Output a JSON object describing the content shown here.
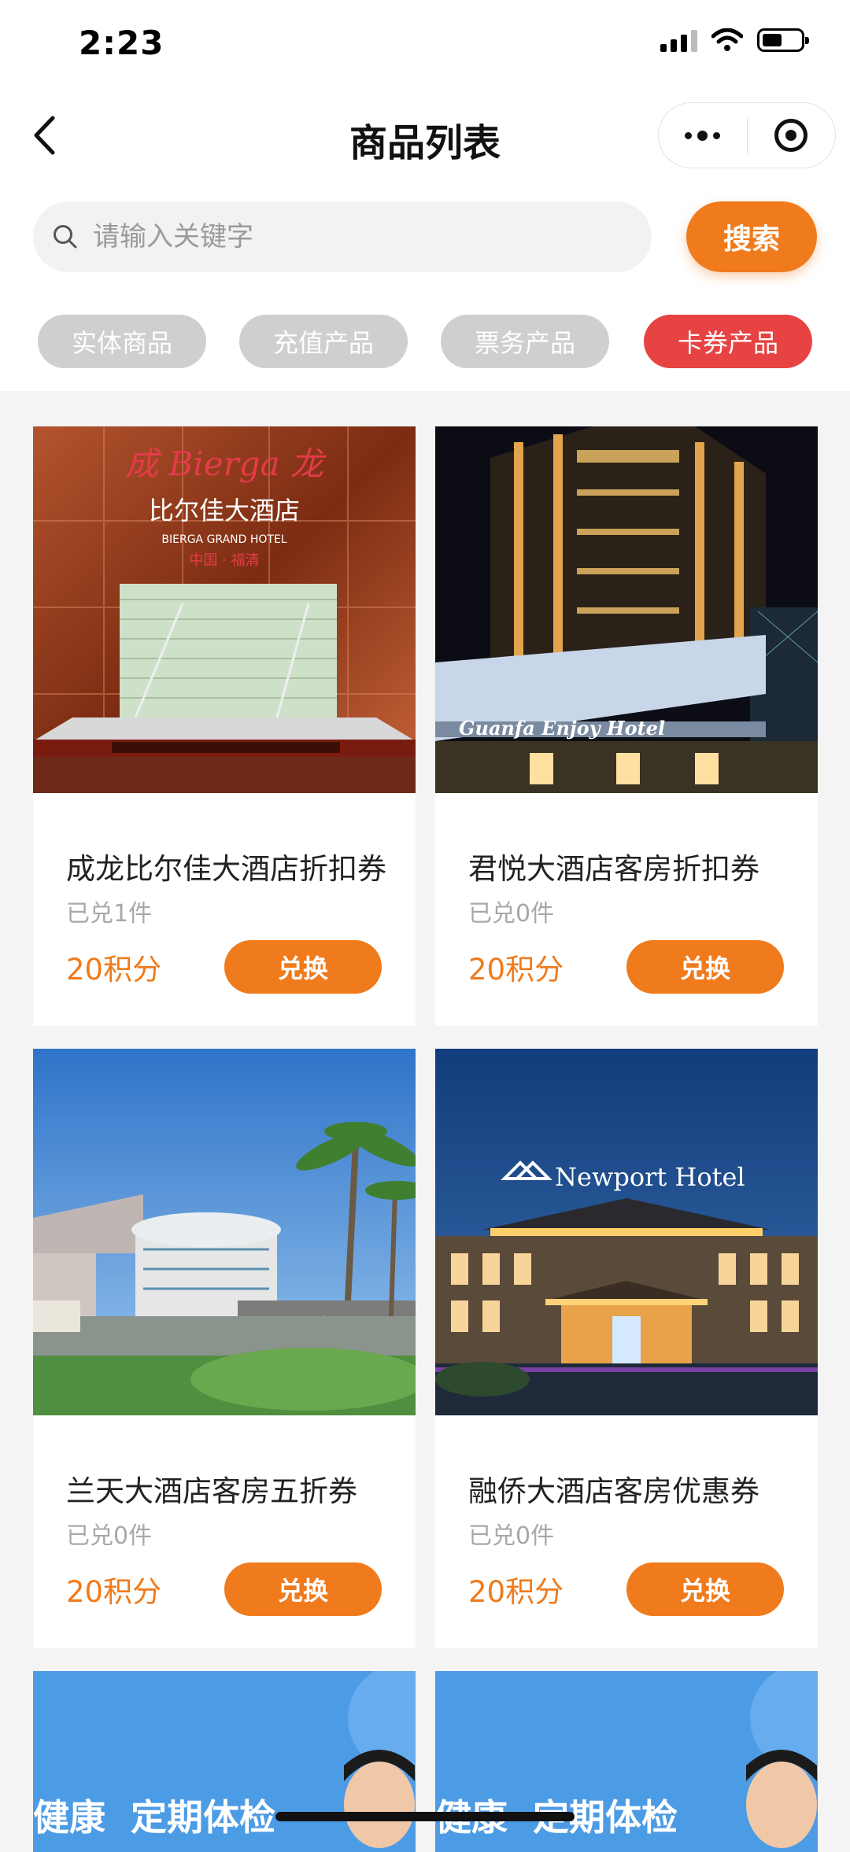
{
  "status_bar": {
    "time": "2:23"
  },
  "nav": {
    "title": "商品列表"
  },
  "search": {
    "placeholder": "请输入关键字",
    "button_label": "搜索"
  },
  "categories": [
    {
      "label": "实体商品",
      "active": false
    },
    {
      "label": "充值产品",
      "active": false
    },
    {
      "label": "票务产品",
      "active": false
    },
    {
      "label": "卡券产品",
      "active": true
    }
  ],
  "products": [
    {
      "name": "成龙比尔佳大酒店折扣券",
      "sold": "已兑1件",
      "price": "20积分",
      "button_label": "兑换",
      "image_text": [
        "成 Bierga 龙",
        "比尔佳大酒店",
        "BIERGA GRAND HOTEL",
        "中国 · 福清"
      ]
    },
    {
      "name": "君悦大酒店客房折扣券",
      "sold": "已兑0件",
      "price": "20积分",
      "button_label": "兑换",
      "image_text": [
        "Guanfa Enjoy Hotel"
      ]
    },
    {
      "name": "兰天大酒店客房五折券",
      "sold": "已兑0件",
      "price": "20积分",
      "button_label": "兑换",
      "image_text": []
    },
    {
      "name": "融侨大酒店客房优惠券",
      "sold": "已兑0件",
      "price": "20积分",
      "button_label": "兑换",
      "image_text": [
        "Newport Hotel"
      ]
    }
  ],
  "partial_banners": [
    {
      "text": "健康  定期体检"
    },
    {
      "text": "健康  定期体检"
    }
  ],
  "colors": {
    "accent": "#f07b1c",
    "active_tab": "#e84343",
    "inactive_tab": "#cfcfcf"
  }
}
